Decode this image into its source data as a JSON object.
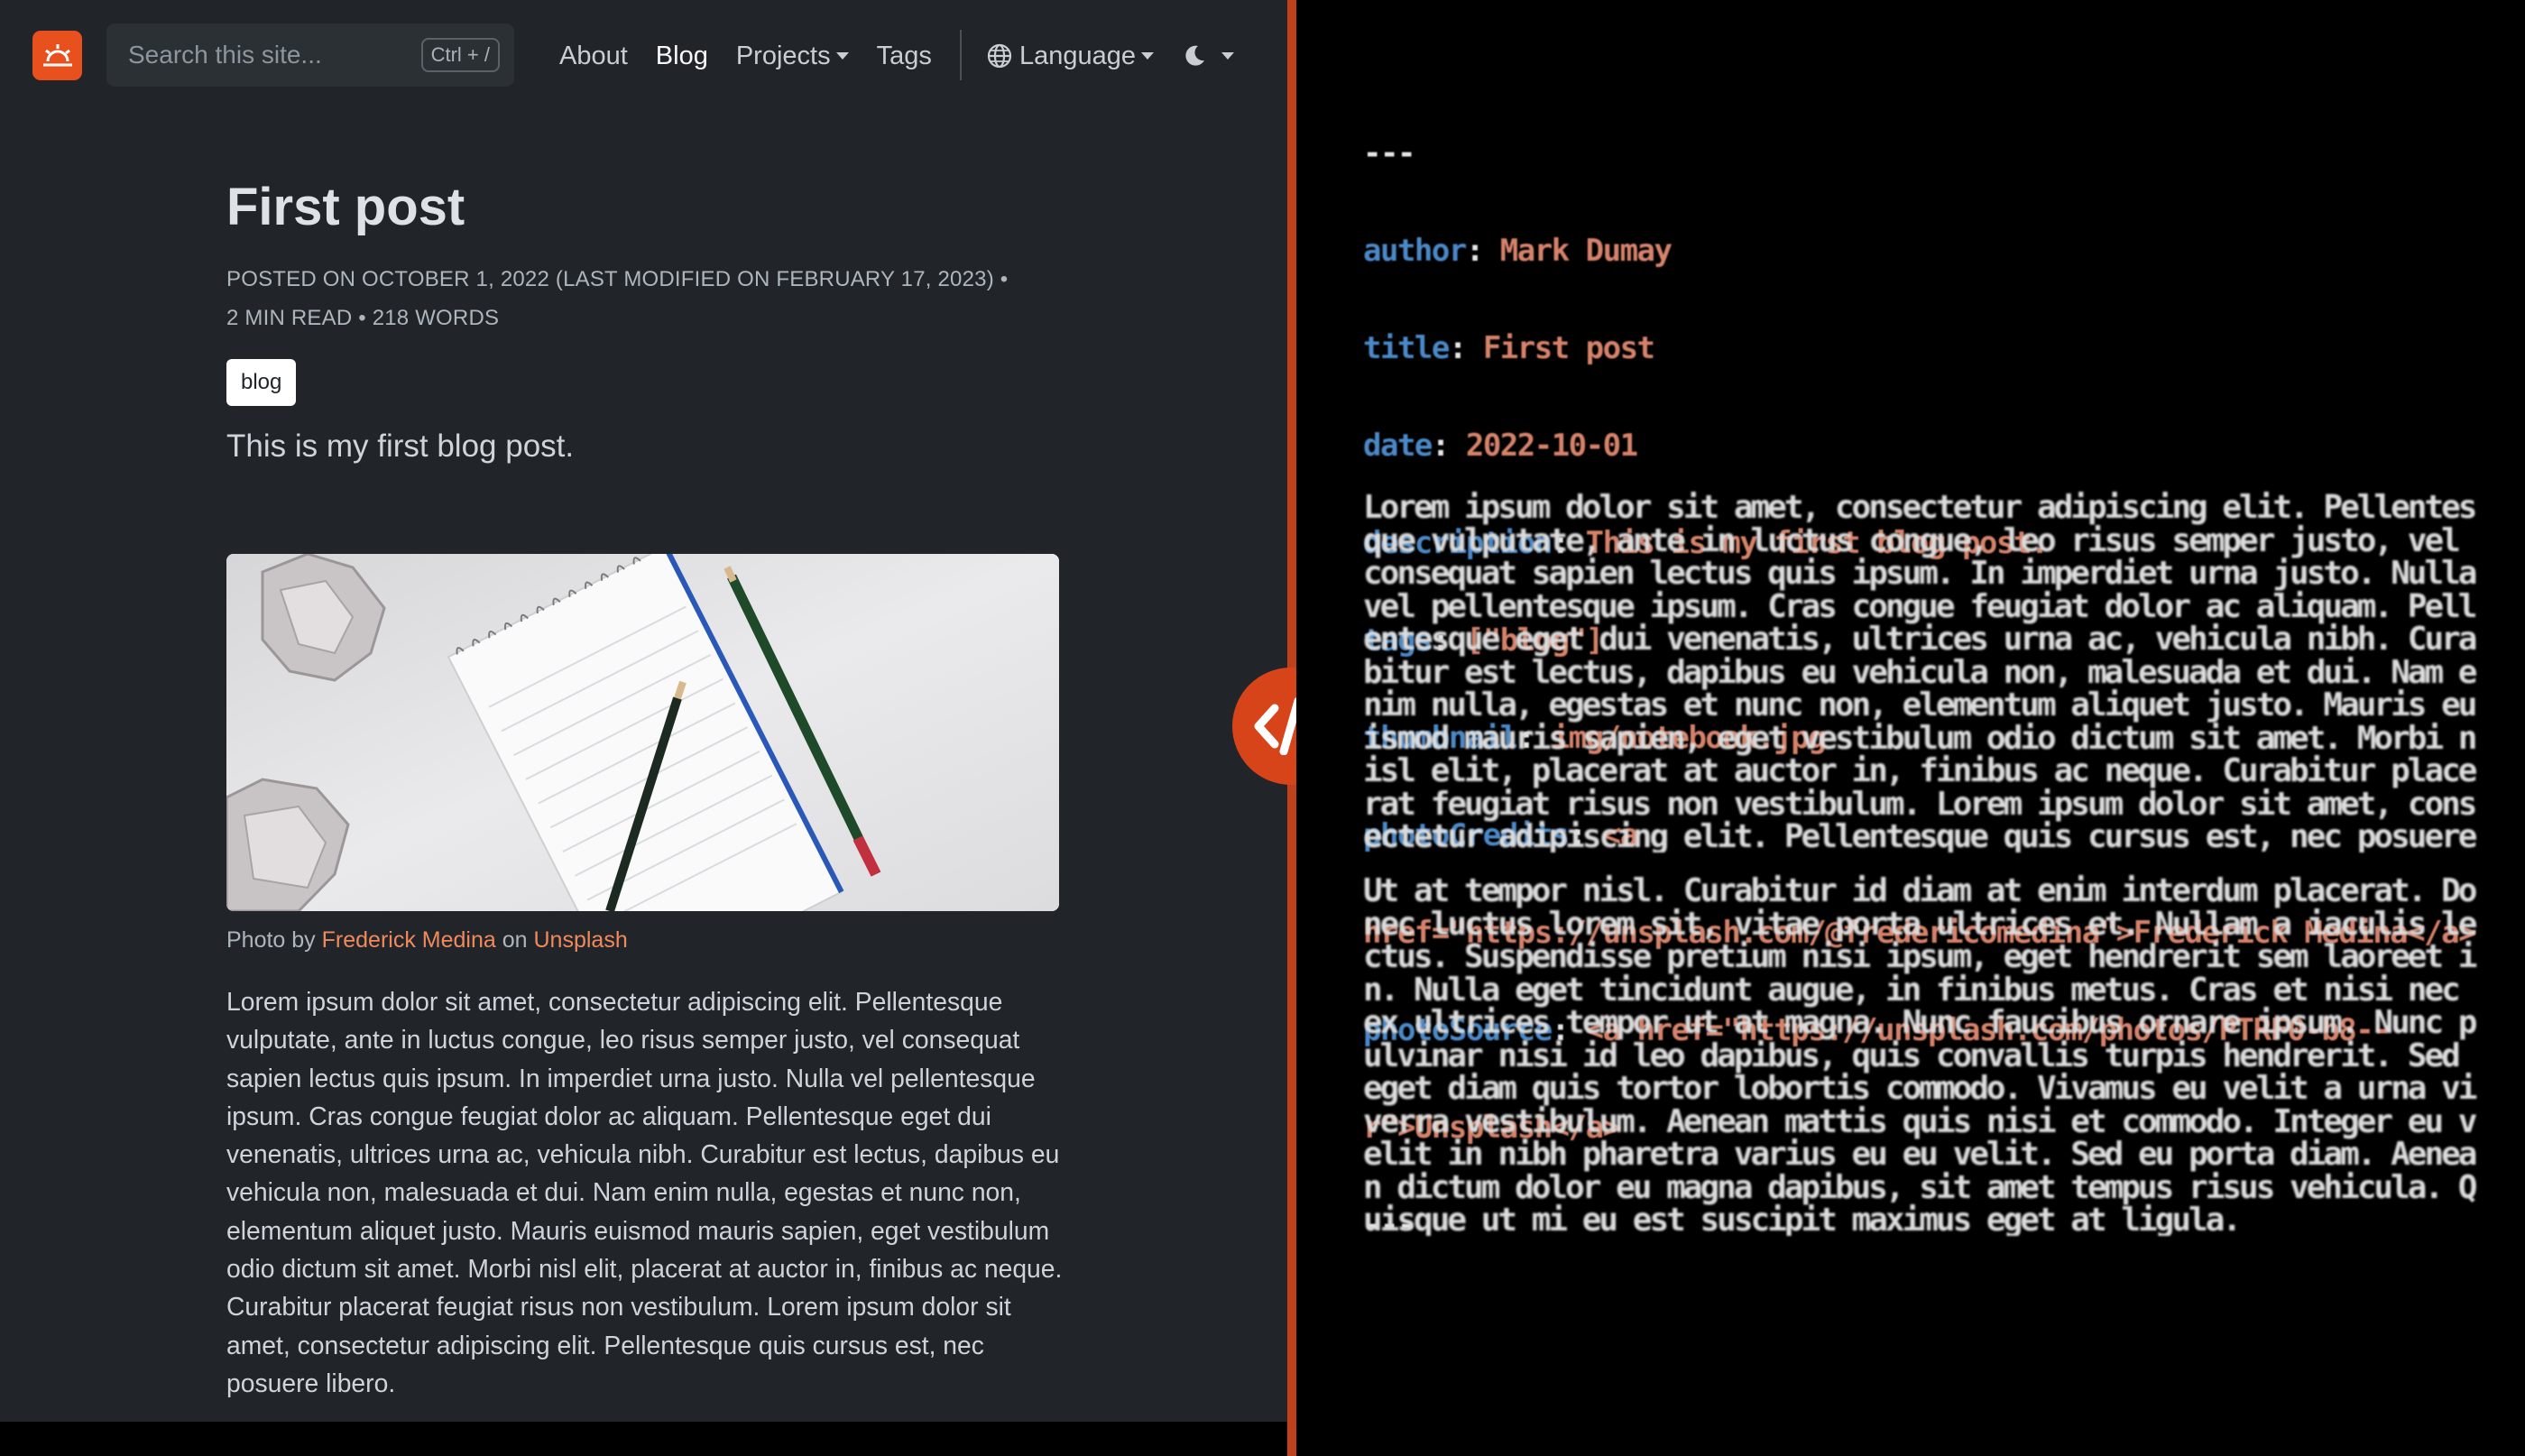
{
  "navbar": {
    "logo_icon": "sunrise-icon",
    "search": {
      "placeholder": "Search this site...",
      "shortcut": "Ctrl + /"
    },
    "links": [
      {
        "label": "About",
        "active": false,
        "dropdown": false
      },
      {
        "label": "Blog",
        "active": true,
        "dropdown": false
      },
      {
        "label": "Projects",
        "active": false,
        "dropdown": true
      },
      {
        "label": "Tags",
        "active": false,
        "dropdown": false
      }
    ],
    "language": {
      "label": "Language",
      "icon": "globe-icon"
    },
    "theme_icon": "moon-icon"
  },
  "article": {
    "title": "First post",
    "meta_line1": "Posted on October 1, 2022 (Last modified on February 17, 2023) •",
    "meta_line2": "2 min read • 218 words",
    "tag": "blog",
    "lead": "This is my first blog post.",
    "caption": {
      "prefix": "Photo by",
      "author": "Frederick Medina",
      "mid": "on",
      "source": "Unsplash"
    },
    "body": "Lorem ipsum dolor sit amet, consectetur adipiscing elit. Pellentesque vulputate, ante in luctus congue, leo risus semper justo, vel consequat sapien lectus quis ipsum. In imperdiet urna justo. Nulla vel pellentesque ipsum. Cras congue feugiat dolor ac aliquam. Pellentesque eget dui venenatis, ultrices urna ac, vehicula nibh. Curabitur est lectus, dapibus eu vehicula non, malesuada et dui. Nam enim nulla, egestas et nunc non, elementum aliquet justo. Mauris euismod mauris sapien, eget vestibulum odio dictum sit amet. Morbi nisl elit, placerat at auctor in, finibus ac neque. Curabitur placerat feugiat risus non vestibulum. Lorem ipsum dolor sit amet, consectetur adipiscing elit. Pellentesque quis cursus est, nec posuere libero."
  },
  "divider_icon": "code-icon",
  "source": {
    "fence": "---",
    "frontmatter": [
      {
        "key": "author",
        "value": "Mark Dumay"
      },
      {
        "key": "title",
        "value": "First post"
      },
      {
        "key": "date",
        "value": "2022-10-01"
      },
      {
        "key": "description",
        "value": "This is my first blog post."
      },
      {
        "key": "tags",
        "value": "[\"blog\"]"
      },
      {
        "key": "thumbnail",
        "value": "img/notebook.jpg"
      },
      {
        "key": "photoCredits",
        "value": "<a"
      },
      {
        "key": "",
        "value": "href=\"https://unsplash.com/@fredericomedina\">Frederick Medina</a>"
      },
      {
        "key": "photoSource",
        "value": "<a href=\"https://unsplash.com/photos/PTRF0-b8--"
      },
      {
        "key": "",
        "value": "r\">Unsplash</a>"
      }
    ],
    "para1": "Lorem ipsum dolor sit amet, consectetur adipiscing elit. Pellentesque vulputate, ante in luctus congue, leo risus semper justo, vel consequat sapien lectus quis ipsum. In imperdiet urna justo. Nulla vel pellentesque ipsum. Cras congue feugiat dolor ac aliquam. Pellentesque eget dui venenatis, ultrices urna ac, vehicula nibh. Curabitur est lectus, dapibus eu vehicula non, malesuada et dui. Nam enim nulla, egestas et nunc non, elementum aliquet justo. Mauris euismod mauris sapien, eget vestibulum odio dictum sit amet. Morbi nisl elit, placerat at auctor in, finibus ac neque. Curabitur placerat feugiat risus non vestibulum. Lorem ipsum dolor sit amet, consectetur adipiscing elit. Pellentesque quis cursus est, nec posuere libero.",
    "para2": "Ut at tempor nisl. Curabitur id diam at enim interdum placerat. Donec luctus lorem sit, vitae porta ultrices et. Nullam a iaculis lectus. Suspendisse pretium nisi ipsum, eget hendrerit sem laoreet in. Nulla eget tincidunt augue, in finibus metus. Cras et nisi nec ex ultrices tempor ut at magna. Nunc faucibus ornare ipsum. Nunc pulvinar nisi id leo dapibus, quis convallis turpis hendrerit. Sed eget diam quis tortor lobortis commodo. Vivamus eu velit a urna viverra vestibulum. Aenean mattis quis nisi et commodo. Integer eu velit in nibh pharetra varius eu eu velit. Sed eu porta diam. Aenean dictum dolor eu magna dapibus, sit amet tempus risus vehicula. Quisque ut mi eu est suscipit maximus eget at ligula."
  },
  "colors": {
    "accent": "#e8501e",
    "link": "#f08a5d",
    "background": "#212529",
    "source_key": "#4a88c7",
    "source_value": "#d6826a"
  }
}
